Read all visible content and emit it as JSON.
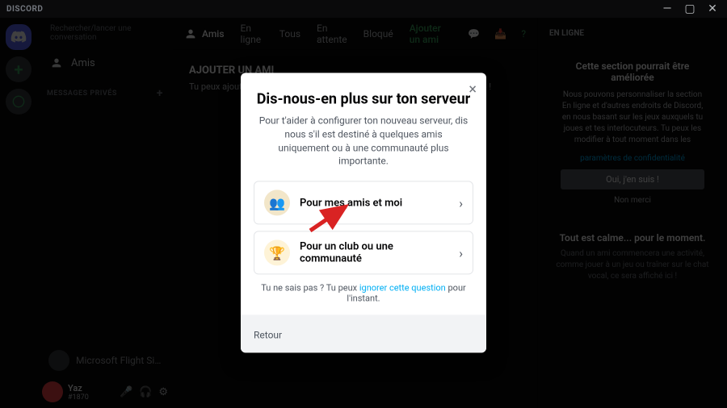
{
  "titlebar": {
    "logo": "DISCORD"
  },
  "sidebar": {
    "search_placeholder": "Rechercher/lancer une conversation",
    "friends_label": "Amis",
    "dm_header": "MESSAGES PRIVÉS",
    "dms": [
      {
        "name": "Microsoft Flight Simul..."
      },
      {
        "name": "Yaz",
        "tag": "#1870"
      }
    ]
  },
  "tabs": {
    "friends": "Amis",
    "online": "En ligne",
    "all": "Tous",
    "pending": "En attente",
    "blocked": "Bloqué",
    "add": "Ajouter un ami"
  },
  "addfriend": {
    "title": "AJOUTER UN AMI",
    "subtitle": "Tu peux ajouter un ami grâce à son Discord Tag. Attention aux mAjUsCuLeS !"
  },
  "now": {
    "header": "EN LIGNE",
    "card_title": "Cette section pourrait être améliorée",
    "card_body": "Nous pouvons personnaliser la section En ligne et d'autres endroits de Discord, en nous basant sur les jeux auxquels tu joues et tes interlocuteurs. Tu peux les modifier à tout moment dans les",
    "card_link": "paramètres de confidentialité",
    "card_btn": "Oui, j'en suis !",
    "card_dismiss": "Non merci",
    "quiet_title": "Tout est calme... pour le moment.",
    "quiet_body": "Quand un ami commencera une activité, comme jouer à un jeu ou traîner sur le chat vocal, ce sera affiché ici !"
  },
  "modal": {
    "title": "Dis-nous-en plus sur ton serveur",
    "desc": "Pour t'aider à configurer ton nouveau serveur, dis nous s'il est destiné à quelques amis uniquement ou à une communauté plus importante.",
    "choice_friends": "Pour mes amis et moi",
    "choice_club": "Pour un club ou une communauté",
    "skip_prefix": "Tu ne sais pas ? Tu peux ",
    "skip_link": "ignorer cette question",
    "skip_suffix": " pour l'instant.",
    "back": "Retour"
  }
}
